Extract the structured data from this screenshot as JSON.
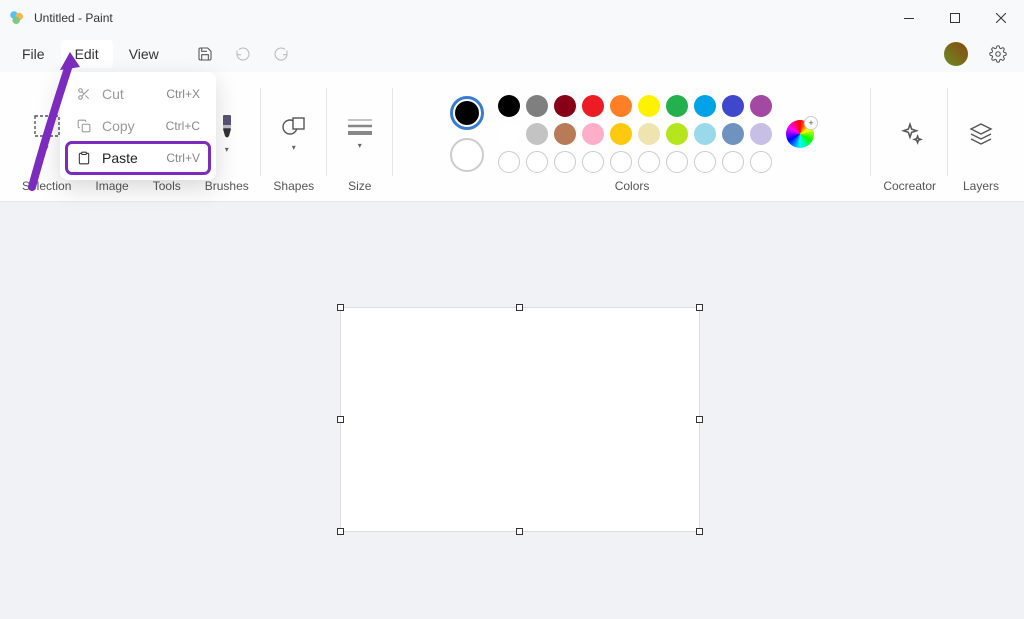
{
  "window": {
    "title": "Untitled - Paint"
  },
  "menubar": {
    "items": [
      {
        "label": "File"
      },
      {
        "label": "Edit"
      },
      {
        "label": "View"
      }
    ]
  },
  "edit_menu": {
    "items": [
      {
        "icon": "scissors",
        "label": "Cut",
        "shortcut": "Ctrl+X",
        "enabled": false
      },
      {
        "icon": "copy",
        "label": "Copy",
        "shortcut": "Ctrl+C",
        "enabled": false
      },
      {
        "icon": "paste",
        "label": "Paste",
        "shortcut": "Ctrl+V",
        "enabled": true,
        "highlighted": true
      }
    ]
  },
  "ribbon": {
    "sections": {
      "selection": "Selection",
      "image": "Image",
      "tools": "Tools",
      "brushes": "Brushes",
      "shapes": "Shapes",
      "size": "Size",
      "colors": "Colors",
      "cocreator": "Cocreator",
      "layers": "Layers"
    }
  },
  "palette": {
    "row1": [
      "#000000",
      "#7f7f7f",
      "#880015",
      "#ed1c24",
      "#ff7f27",
      "#fff200",
      "#22b14c",
      "#00a2e8",
      "#3f48cc",
      "#a349a4"
    ],
    "row2": [
      "#ffffff",
      "#c3c3c3",
      "#b97a57",
      "#ffaec9",
      "#ffc90e",
      "#efe4b0",
      "#b5e61d",
      "#99d9ea",
      "#7092be",
      "#c8bfe7"
    ],
    "empty_slots": 10,
    "primary": "#000000",
    "secondary": "#ffffff"
  }
}
